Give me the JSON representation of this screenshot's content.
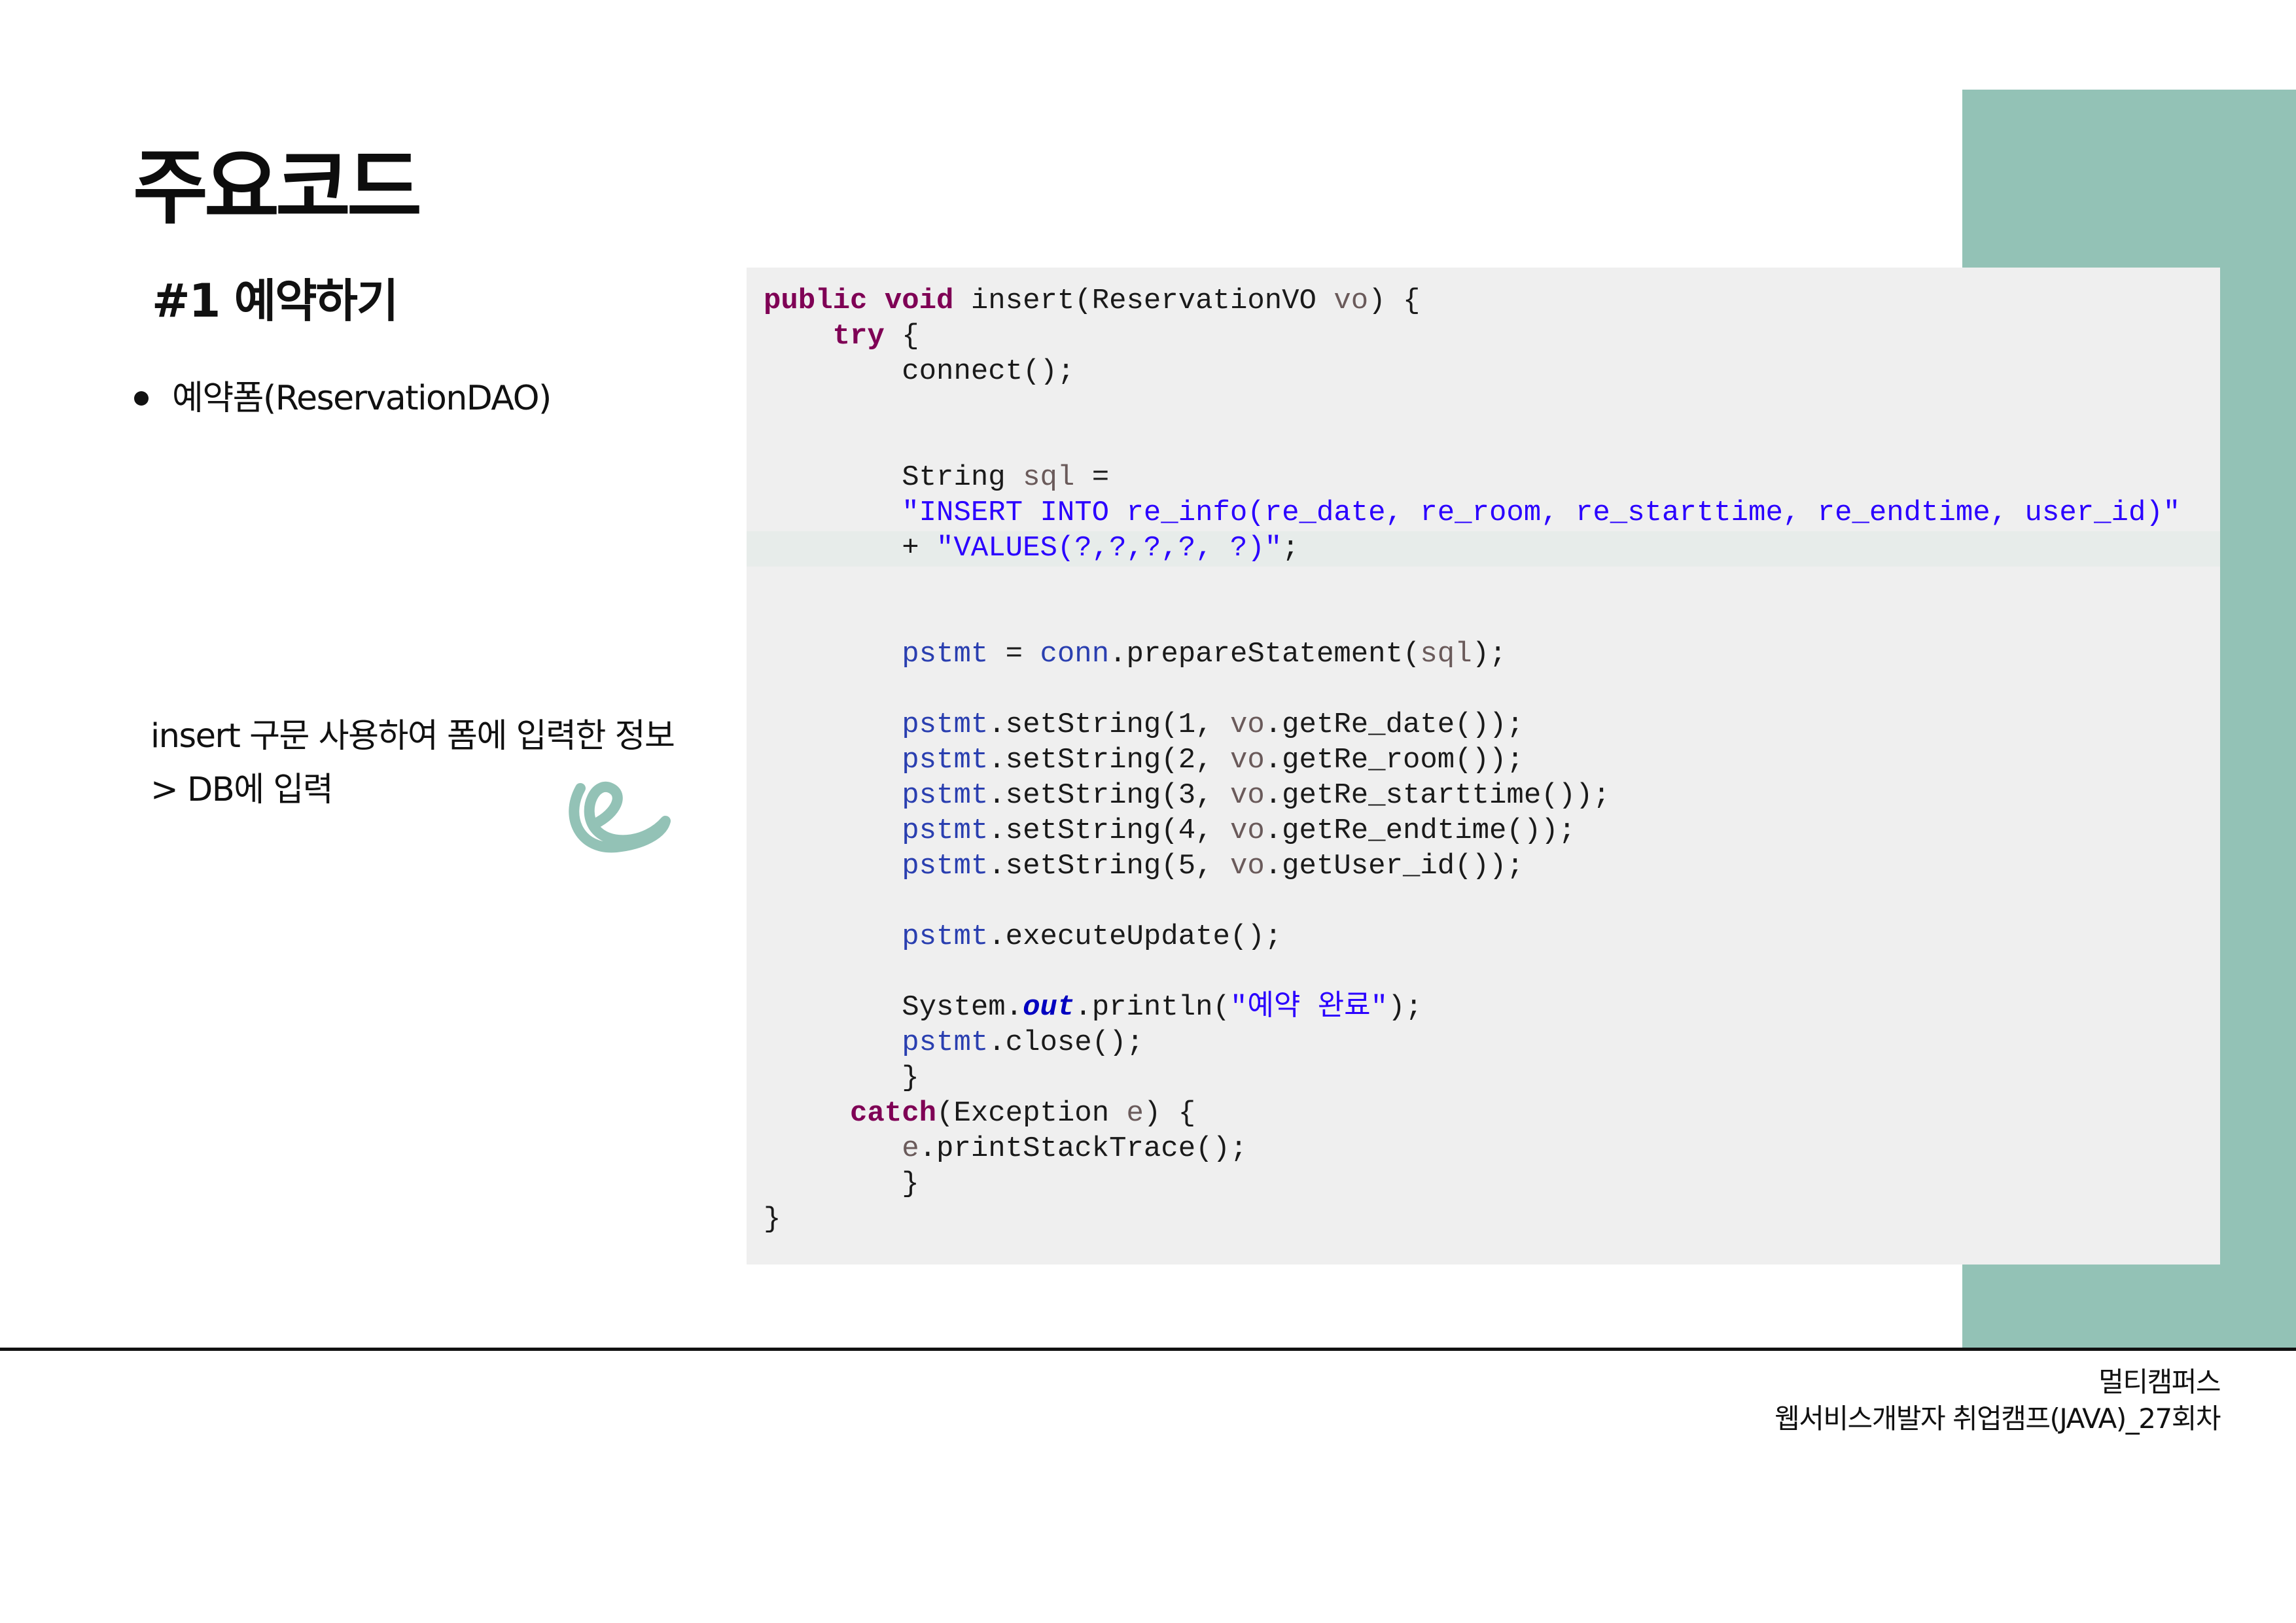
{
  "slide": {
    "title": "주요코드",
    "section_heading": "#1 예약하기",
    "bullet": "예약폼(ReservationDAO)",
    "description_lines": [
      "insert 구문 사용하여 폼에 입력한 정보",
      "> DB에 입력"
    ],
    "accent_color": "#93c2b6"
  },
  "code": {
    "language": "java",
    "lines": [
      "public void insert(ReservationVO vo) {",
      "    try {",
      "        connect();",
      "",
      "",
      "        String sql =",
      "        \"INSERT INTO re_info(re_date, re_room, re_starttime, re_endtime, user_id)\"",
      "        + \"VALUES(?,?,?,?, ?)\";",
      "",
      "",
      "        pstmt = conn.prepareStatement(sql);",
      "",
      "        pstmt.setString(1, vo.getRe_date());",
      "        pstmt.setString(2, vo.getRe_room());",
      "        pstmt.setString(3, vo.getRe_starttime());",
      "        pstmt.setString(4, vo.getRe_endtime());",
      "        pstmt.setString(5, vo.getUser_id());",
      "",
      "        pstmt.executeUpdate();",
      "",
      "        System.out.println(\"예약 완료\");",
      "        pstmt.close();",
      "        }",
      "     catch(Exception e) {",
      "        e.printStackTrace();",
      "        }",
      "}"
    ]
  },
  "footer": {
    "line1": "멀티캠퍼스",
    "line2": "웹서비스개발자 취업캠프(JAVA)_27회차"
  }
}
